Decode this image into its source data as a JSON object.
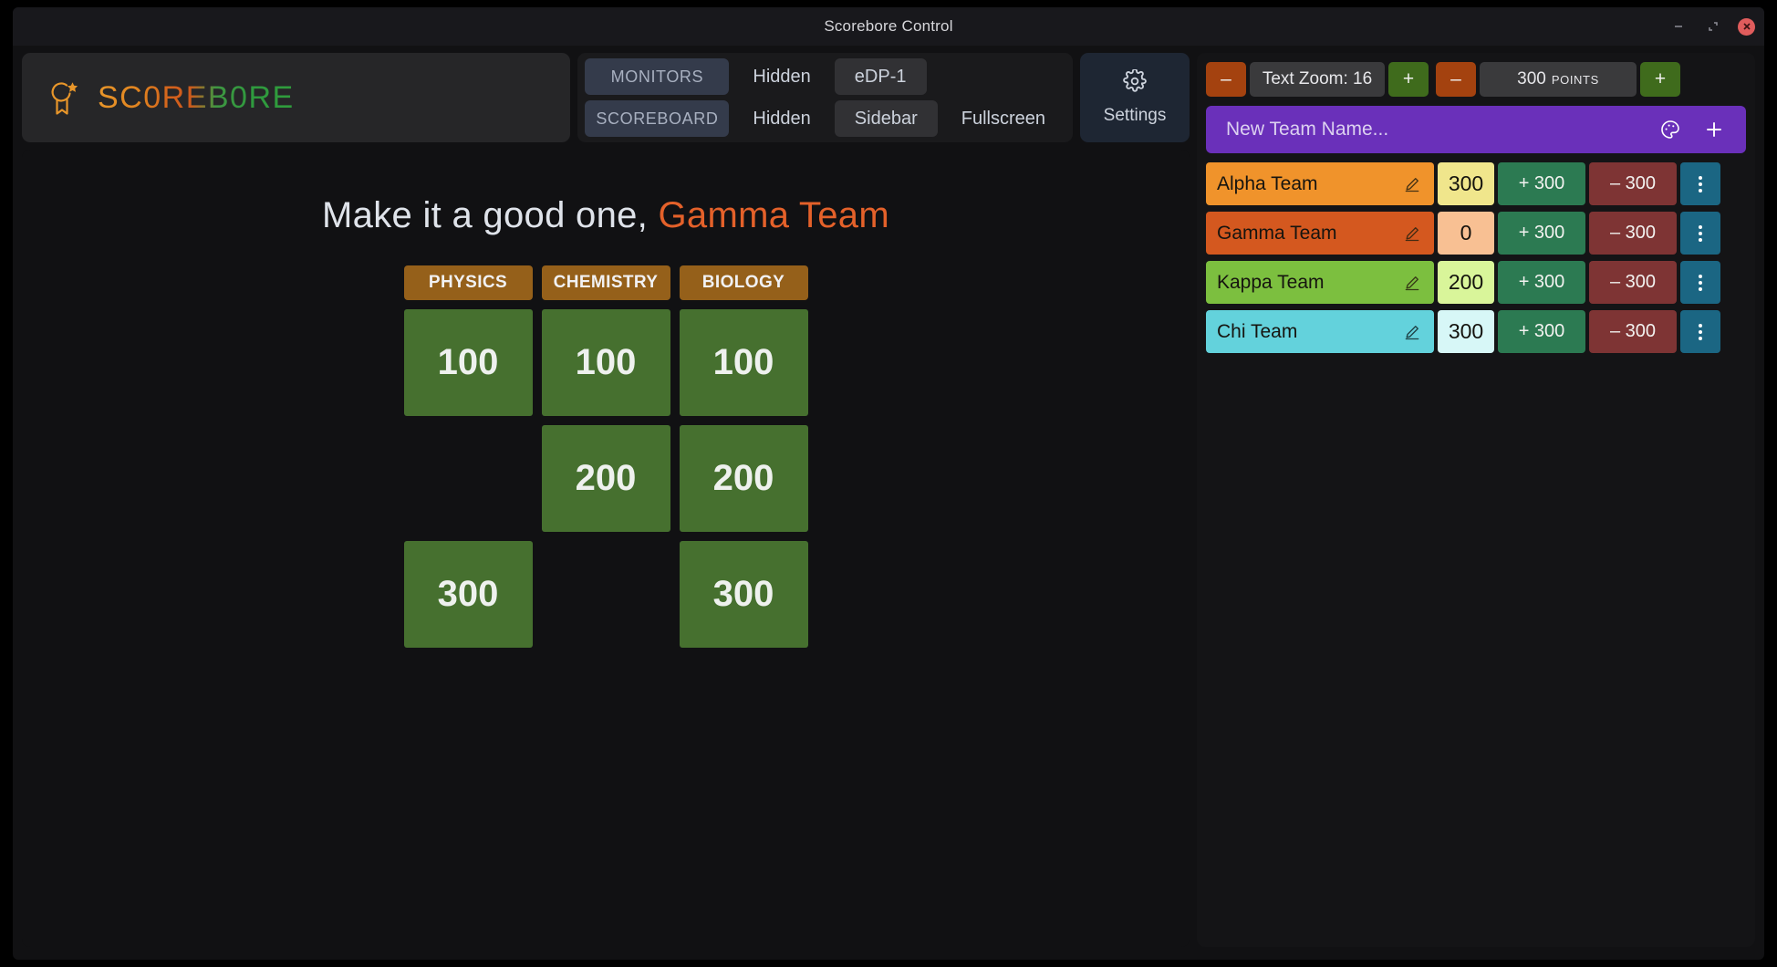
{
  "window": {
    "title": "Scorebore Control",
    "controls": [
      {
        "name": "minimize",
        "glyph": "–"
      },
      {
        "name": "maximize",
        "glyph": "⤡"
      },
      {
        "name": "close",
        "glyph": "✕"
      }
    ]
  },
  "brand": {
    "logo_icon": "medal-star-icon",
    "name": "SC0REB0RE",
    "gradient_from": "#e8962a",
    "gradient_to": "#2f9c3c"
  },
  "toggles": {
    "monitors": {
      "label": "MONITORS",
      "options": [
        "Hidden",
        "eDP-1"
      ],
      "selected": "eDP-1"
    },
    "scoreboard": {
      "label": "SCOREBOARD",
      "options": [
        "Hidden",
        "Sidebar",
        "Fullscreen"
      ],
      "selected": "Sidebar"
    }
  },
  "settings": {
    "icon": "gear-icon",
    "label": "Settings"
  },
  "board": {
    "heading_prefix": "Make it a good one, ",
    "heading_team": "Gamma Team",
    "heading_team_color": "#e4612a",
    "categories": [
      "PHYSICS",
      "CHEMISTRY",
      "BIOLOGY"
    ],
    "rows": [
      [
        "100",
        "100",
        "100"
      ],
      [
        "",
        "200",
        "200"
      ],
      [
        "300",
        "",
        "300"
      ]
    ],
    "tile_color": "#46702f",
    "category_color": "#95601a"
  },
  "counters": {
    "text_zoom": {
      "minus_label": "–",
      "display": "Text Zoom: 16",
      "plus_label": "+"
    },
    "points": {
      "minus_label": "–",
      "value": "300",
      "unit": "POINTS",
      "plus_label": "+"
    }
  },
  "new_team": {
    "placeholder": "New Team Name...",
    "value": "",
    "palette_icon": "palette-icon",
    "add_icon": "plus-icon",
    "background": "#6a30ba"
  },
  "teams": [
    {
      "name": "Alpha Team",
      "score": "300",
      "add_label": "+ 300",
      "sub_label": "– 300",
      "name_bg": "#f0932b",
      "score_bg": "#f0e68c"
    },
    {
      "name": "Gamma Team",
      "score": "0",
      "add_label": "+ 300",
      "sub_label": "– 300",
      "name_bg": "#d4581f",
      "score_bg": "#f8c093"
    },
    {
      "name": "Kappa Team",
      "score": "200",
      "add_label": "+ 300",
      "sub_label": "– 300",
      "name_bg": "#7cbf3f",
      "score_bg": "#d9f59a"
    },
    {
      "name": "Chi Team",
      "score": "300",
      "add_label": "+ 300",
      "sub_label": "– 300",
      "name_bg": "#63d2dc",
      "score_bg": "#d7f7f7"
    }
  ]
}
